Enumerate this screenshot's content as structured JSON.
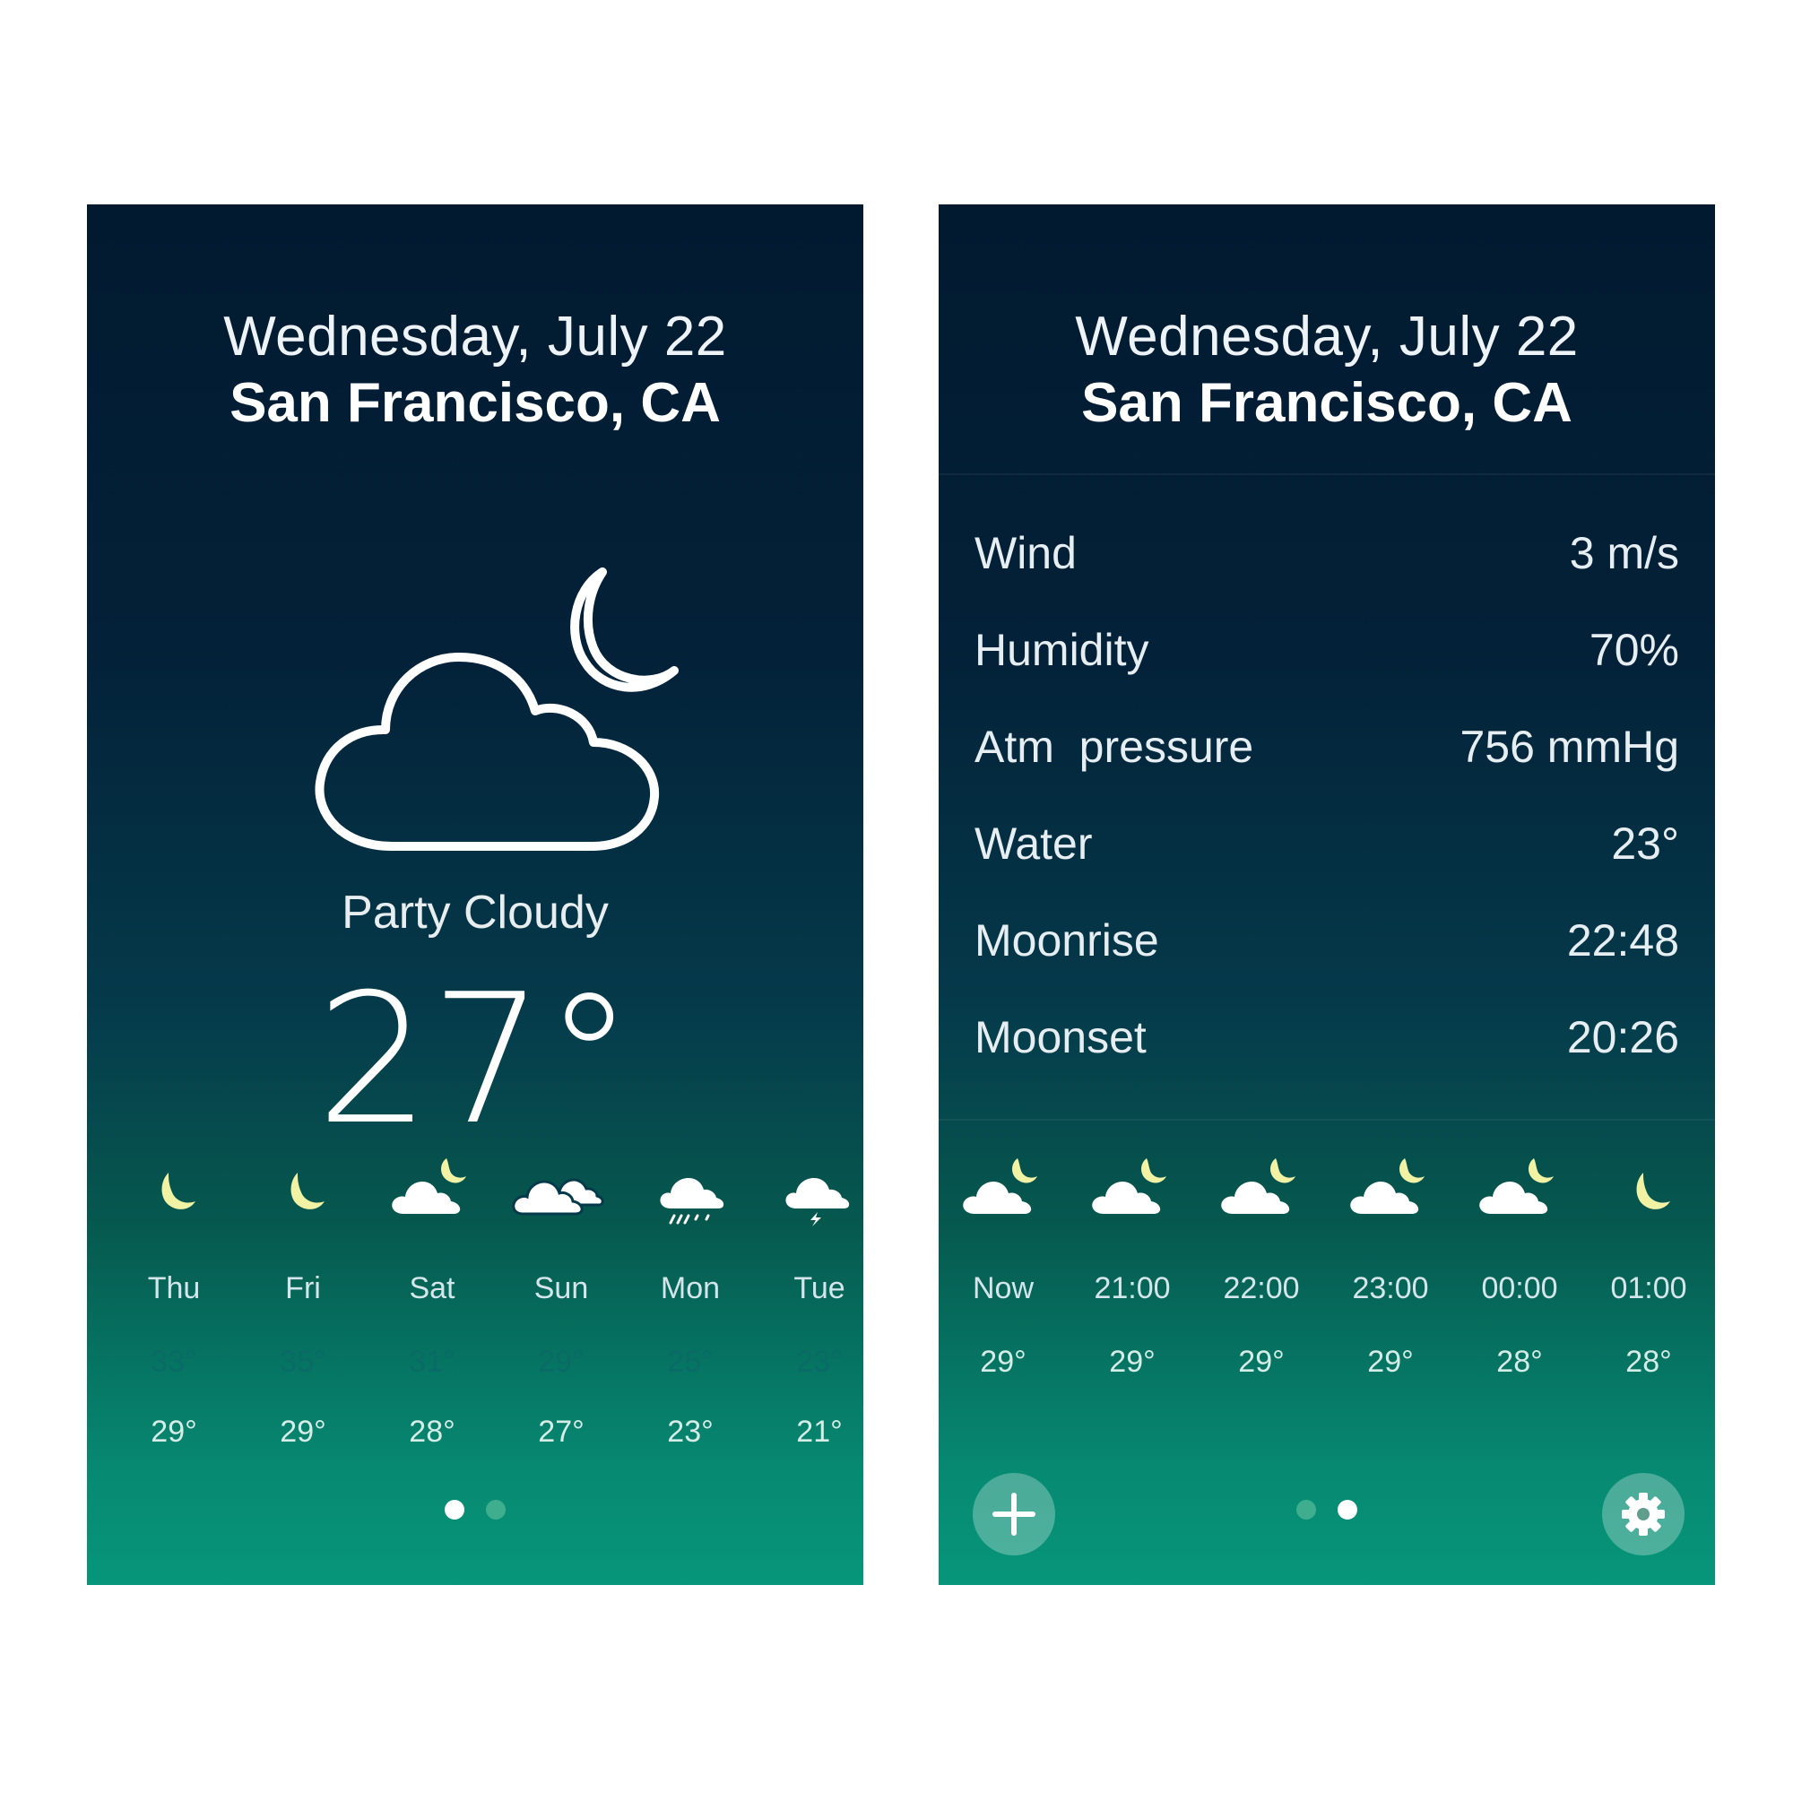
{
  "colors": {
    "gradient_top": "#021a30",
    "gradient_bottom": "#07967a",
    "moon": "#f1f2a4",
    "high_temp": "#0a6a66",
    "dot_active": "#ffffff",
    "dot_inactive": "#3fae8f"
  },
  "left": {
    "date": "Wednesday, July 22",
    "city": "San Francisco, CA",
    "main_icon": "cloud-moon-icon",
    "condition": "Party Cloudy",
    "temperature": "27°",
    "forecast": [
      {
        "day": "Thu",
        "icon": "moon-icon",
        "high": "33°",
        "low": "29°"
      },
      {
        "day": "Fri",
        "icon": "moon-icon",
        "high": "35°",
        "low": "29°"
      },
      {
        "day": "Sat",
        "icon": "cloud-moon-icon",
        "high": "31°",
        "low": "28°"
      },
      {
        "day": "Sun",
        "icon": "clouds-icon",
        "high": "29°",
        "low": "27°"
      },
      {
        "day": "Mon",
        "icon": "cloud-rain-icon",
        "high": "25°",
        "low": "23°"
      },
      {
        "day": "Tue",
        "icon": "cloud-lightning-icon",
        "high": "23°",
        "low": "21°"
      }
    ],
    "page_indicator": {
      "pages": 2,
      "active": 1
    }
  },
  "right": {
    "date": "Wednesday, July 22",
    "city": "San Francisco, CA",
    "details": [
      {
        "label": "Wind",
        "value": "3 m/s"
      },
      {
        "label": "Humidity",
        "value": "70%"
      },
      {
        "label": "Atm  pressure",
        "value": "756 mmHg"
      },
      {
        "label": "Water",
        "value": "23°"
      },
      {
        "label": "Moonrise",
        "value": "22:48"
      },
      {
        "label": "Moonset",
        "value": "20:26"
      }
    ],
    "hourly": [
      {
        "time": "Now",
        "icon": "cloud-moon-icon",
        "temp": "29°"
      },
      {
        "time": "21:00",
        "icon": "cloud-moon-icon",
        "temp": "29°"
      },
      {
        "time": "22:00",
        "icon": "cloud-moon-icon",
        "temp": "29°"
      },
      {
        "time": "23:00",
        "icon": "cloud-moon-icon",
        "temp": "29°"
      },
      {
        "time": "00:00",
        "icon": "cloud-moon-icon",
        "temp": "28°"
      },
      {
        "time": "01:00",
        "icon": "moon-icon",
        "temp": "28°"
      }
    ],
    "page_indicator": {
      "pages": 2,
      "active": 2
    },
    "add_button_icon": "plus-icon",
    "settings_button_icon": "gear-icon"
  }
}
